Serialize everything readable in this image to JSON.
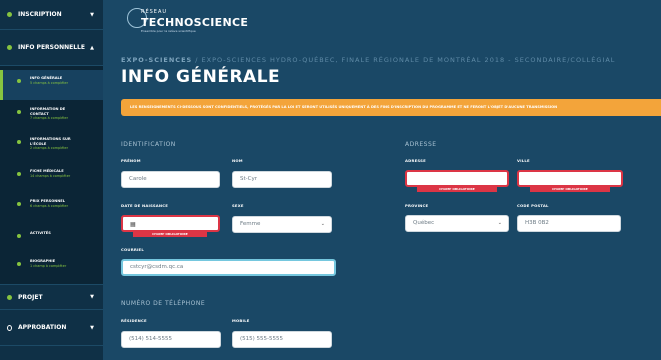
{
  "sidebar": {
    "inscription": "INSCRIPTION",
    "info_perso": "INFO PERSONNELLE",
    "projet": "PROJET",
    "approbation": "APPROBATION",
    "items": [
      {
        "title": "INFO GÉNÉRALE",
        "sub": "5 champs à compléter"
      },
      {
        "title": "INFORMATION DE CONTACT",
        "sub": "7 champs à compléter"
      },
      {
        "title": "INFORMATIONS SUR L'ÉCOLE",
        "sub": "2 champs à compléter"
      },
      {
        "title": "FICHE MÉDICALE",
        "sub": "14 champs à compléter"
      },
      {
        "title": "PRIX PERSONNEL",
        "sub": "6 champs à compléter"
      },
      {
        "title": "ACTIVITÉS",
        "sub": ""
      },
      {
        "title": "BIOGRAPHIE",
        "sub": "1 champ à compléter"
      }
    ],
    "chev_down": "▼",
    "chev_up": "▲"
  },
  "logo": {
    "small": "RÉSEAU",
    "big": "TECHNOSCIENCE",
    "tag": "Ensemble pour la relève scientifique"
  },
  "breadcrumb": {
    "strong": "EXPO-SCIENCES",
    "rest": " / EXPO-SCIENCES HYDRO-QUÉBEC, FINALE RÉGIONALE DE MONTRÉAL 2018 - SECONDAIRE/COLLÉGIAL"
  },
  "title": "INFO GÉNÉRALE",
  "banner": "LES RENSEIGNEMENTS CI-DESSOUS SONT CONFIDENTIELS, PROTÉGÉS PAR LA LOI ET SERONT UTILISÉS UNIQUEMENT À DES FINS D'INSCRIPTION DU PROGRAMME ET NE FERONT L'OBJET D'AUCUNE TRANSMISSION",
  "sections": {
    "identification": "IDENTIFICATION",
    "adresse": "ADRESSE",
    "telephone": "NUMÉRO DE TÉLÉPHONE"
  },
  "labels": {
    "prenom": "PRÉNOM",
    "nom": "NOM",
    "naissance": "DATE DE NAISSANCE",
    "sexe": "SEXE",
    "courriel": "COURRIEL",
    "adresse": "ADRESSE",
    "ville": "VILLE",
    "province": "PROVINCE",
    "code_postal": "CODE POSTAL",
    "residence": "RÉSIDENCE",
    "mobile": "MOBILE"
  },
  "values": {
    "prenom": "Carole",
    "nom": "St-Cyr",
    "naissance": "",
    "sexe": "Femme",
    "courriel": "cstcyr@csdm.qc.ca",
    "adresse": "",
    "ville": "",
    "province": "Québec",
    "code_postal": "H3B 0B2",
    "residence": "(514) 514-5555",
    "mobile": "(515) 555-5555"
  },
  "error_text": "CHAMP OBLIGATOIRE",
  "icons": {
    "calendar": "▦",
    "chevron": "⌄"
  }
}
